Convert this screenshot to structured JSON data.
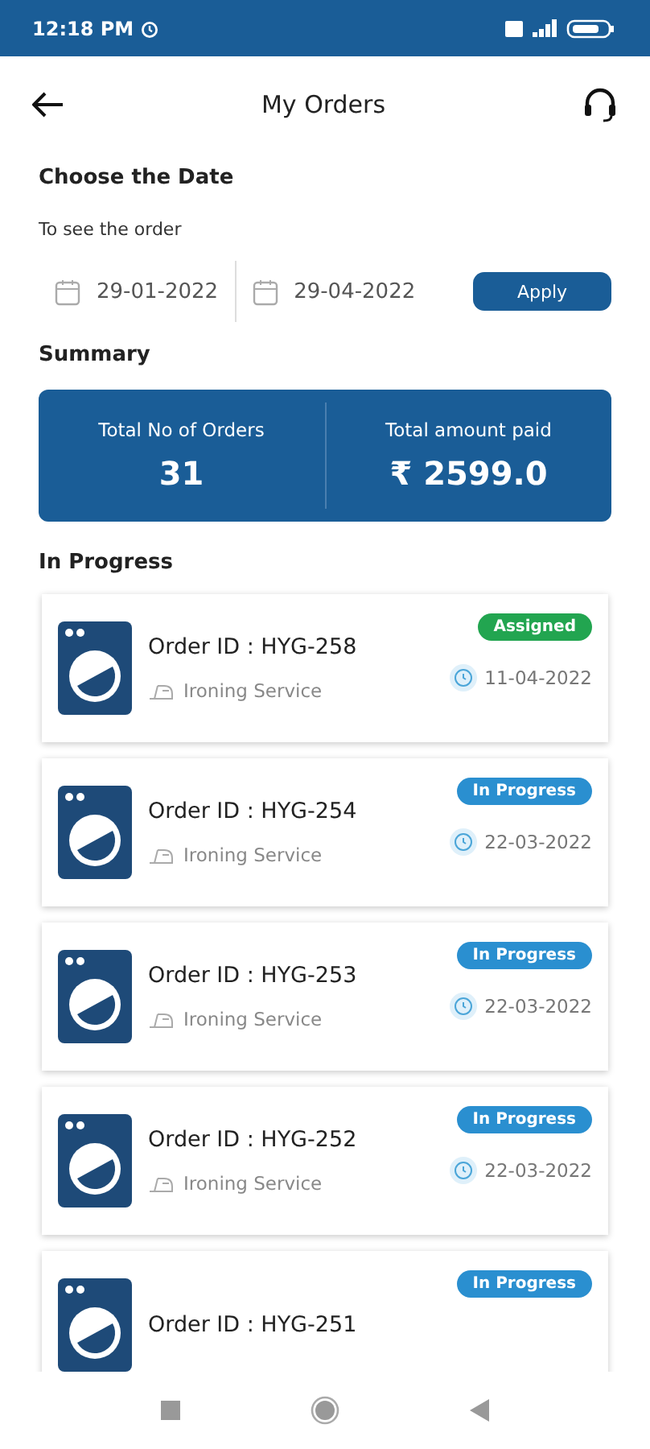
{
  "status_bar": {
    "time": "12:18 PM"
  },
  "header": {
    "title": "My Orders"
  },
  "date_filter": {
    "heading": "Choose the Date",
    "subtitle": "To see the order",
    "from": "29-01-2022",
    "to": "29-04-2022",
    "apply": "Apply"
  },
  "summary": {
    "heading": "Summary",
    "stats": [
      {
        "label": "Total No of Orders",
        "value": "31"
      },
      {
        "label": "Total amount paid",
        "value": "₹ 2599.0"
      }
    ]
  },
  "orders": {
    "heading": "In Progress",
    "items": [
      {
        "order_id": "Order ID : HYG-258",
        "service": "Ironing Service",
        "date": "11-04-2022",
        "status": "Assigned",
        "kind": "assigned"
      },
      {
        "order_id": "Order ID : HYG-254",
        "service": "Ironing Service",
        "date": "22-03-2022",
        "status": "In Progress",
        "kind": "in_progress"
      },
      {
        "order_id": "Order ID : HYG-253",
        "service": "Ironing Service",
        "date": "22-03-2022",
        "status": "In Progress",
        "kind": "in_progress"
      },
      {
        "order_id": "Order ID : HYG-252",
        "service": "Ironing Service",
        "date": "22-03-2022",
        "status": "In Progress",
        "kind": "in_progress"
      },
      {
        "order_id": "Order ID : HYG-251",
        "status": "In Progress",
        "kind": "in_progress"
      }
    ]
  }
}
